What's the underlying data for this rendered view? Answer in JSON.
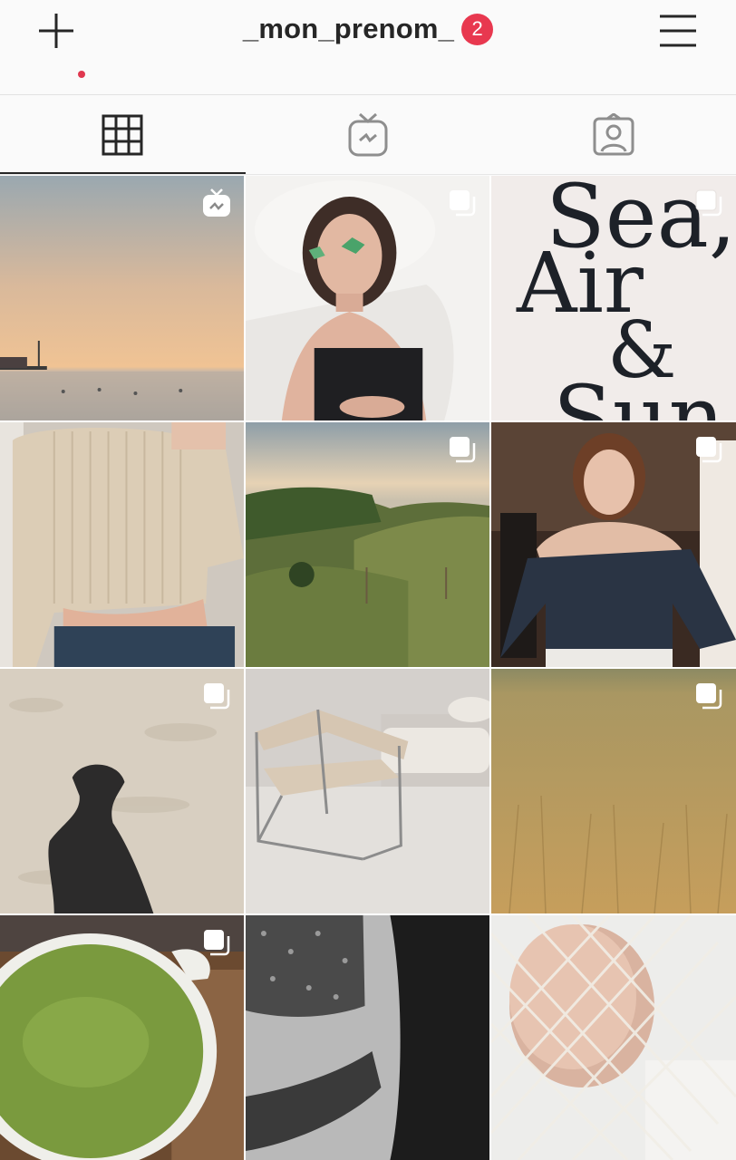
{
  "header": {
    "username": "_mon_prenom_",
    "notification_count": "2",
    "plus_icon": "plus-icon",
    "menu_icon": "hamburger-menu-icon"
  },
  "tabs": [
    {
      "name": "grid",
      "icon": "grid-icon",
      "active": true
    },
    {
      "name": "igtv",
      "icon": "igtv-icon",
      "active": false
    },
    {
      "name": "tagged",
      "icon": "tagged-person-icon",
      "active": false
    }
  ],
  "posts": [
    {
      "subject": "sunset over sea with pier",
      "overlay": "igtv"
    },
    {
      "subject": "girl lying on bed with eye patches",
      "overlay": "carousel"
    },
    {
      "subject": "typography poster",
      "overlay": "carousel",
      "poster_lines": [
        "Sea,",
        "Air",
        "&",
        "Sun"
      ]
    },
    {
      "subject": "beige knit sweater and jeans",
      "overlay": "none"
    },
    {
      "subject": "green hills at dusk",
      "overlay": "carousel"
    },
    {
      "subject": "girl in black corset top",
      "overlay": "carousel"
    },
    {
      "subject": "shadow on sand",
      "overlay": "carousel"
    },
    {
      "subject": "tubular steel lounge chair",
      "overlay": "none"
    },
    {
      "subject": "dry grass field",
      "overlay": "carousel"
    },
    {
      "subject": "matcha latte cup",
      "overlay": "carousel"
    },
    {
      "subject": "black and white floral lingerie",
      "overlay": "none"
    },
    {
      "subject": "face behind mesh net bag",
      "overlay": "none"
    }
  ],
  "colors": {
    "badge": "#e8384f",
    "text": "#262626",
    "background": "#fafafa"
  }
}
